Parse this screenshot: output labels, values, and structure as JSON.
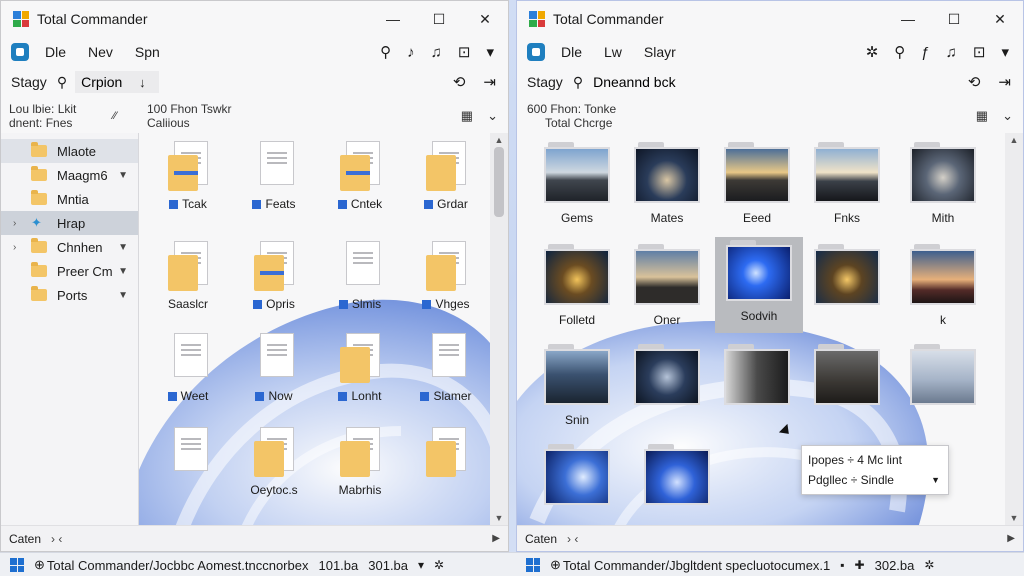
{
  "left": {
    "title": "Total Commander",
    "window_buttons": [
      "—",
      "☐",
      "✕"
    ],
    "menu": [
      "Dle",
      "Nev",
      "Spn"
    ],
    "path_label": "Stagy",
    "path_value": "Crpion",
    "path_caret": "↓",
    "header_col1_line1": "Lou lbie: Lkit",
    "header_col1_line2": "dnent: Fnes",
    "header_col2_line1": "100 Fhon Tswkr",
    "header_col2_line2": "Caliious",
    "header_sort": "⁄⁄",
    "tree": [
      {
        "label": "Mlaote",
        "chevron": ""
      },
      {
        "label": "Maagm6",
        "chevron": "▼"
      },
      {
        "label": "Mntia",
        "chevron": ""
      },
      {
        "label": "Hrap",
        "chevron": ""
      },
      {
        "label": "Chnhen",
        "chevron": "▼"
      },
      {
        "label": "Preer Cm",
        "chevron": "▼"
      },
      {
        "label": "Ports",
        "chevron": "▼"
      }
    ],
    "files": [
      {
        "label": "Tcak"
      },
      {
        "label": "Feats"
      },
      {
        "label": "Cntek"
      },
      {
        "label": "Grdar"
      },
      {
        "label": "Saaslcr"
      },
      {
        "label": "Opris"
      },
      {
        "label": "Slmis"
      },
      {
        "label": "Vhges"
      },
      {
        "label": "Weet"
      },
      {
        "label": "Now"
      },
      {
        "label": "Lonht"
      },
      {
        "label": "Slamer"
      },
      {
        "label": ""
      },
      {
        "label": "Oeytoc.s"
      },
      {
        "label": "Mabrhis"
      },
      {
        "label": ""
      }
    ],
    "status": "Caten",
    "status_nav": "› ‹",
    "taskbar_text": "Total Commander/Jocbbc Aomest.tnccnorbex",
    "taskbar_size": "101.ba",
    "taskbar_size2": "301.ba"
  },
  "right": {
    "title": "Total Commander",
    "window_buttons": [
      "—",
      "☐",
      "✕"
    ],
    "menu": [
      "Dle",
      "Lw",
      "Slayr"
    ],
    "path_label": "Stagy",
    "path_value": "Dneannd bck",
    "header_col1_line1": "600 Fhon: Tonke",
    "header_col1_line2": "Total Chcrge",
    "thumbs": [
      {
        "label": "Gems"
      },
      {
        "label": "Mates"
      },
      {
        "label": "Eeed"
      },
      {
        "label": "Fnks"
      },
      {
        "label": "Mith"
      },
      {
        "label": "Folletd"
      },
      {
        "label": "Oner"
      },
      {
        "label": "Sodvih"
      },
      {
        "label": ""
      },
      {
        "label": "k"
      },
      {
        "label": "Snin"
      },
      {
        "label": ""
      },
      {
        "label": ""
      },
      {
        "label": ""
      },
      {
        "label": ""
      },
      {
        "label": ""
      },
      {
        "label": ""
      }
    ],
    "tooltip_line1": "Ipopes ÷ 4 Mc lint",
    "tooltip_line2": "Pdgllec ÷ Sindle",
    "status": "Caten",
    "status_nav": "› ‹",
    "taskbar_text": "Total Commander/Jbgltdent specluotocumex.1",
    "taskbar_size": "302.ba"
  },
  "icons": {
    "tool_left": [
      "⚲",
      "♪",
      "♫",
      "⊡",
      "▾"
    ],
    "tool_right": [
      "✲",
      "⚲",
      "ƒ",
      "♫",
      "⊡",
      "▾"
    ]
  }
}
